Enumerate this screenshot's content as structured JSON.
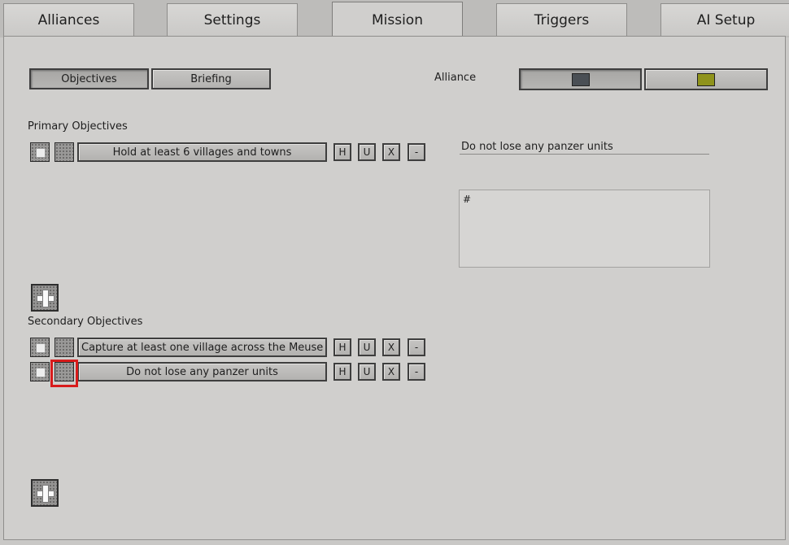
{
  "tabs": [
    {
      "label": "Alliances"
    },
    {
      "label": "Settings"
    },
    {
      "label": "Mission"
    },
    {
      "label": "Triggers"
    },
    {
      "label": "AI Setup"
    }
  ],
  "subtabs": {
    "objectives": "Objectives",
    "briefing": "Briefing"
  },
  "alliance": {
    "label": "Alliance",
    "colors": [
      "#4a4f55",
      "#8f931c"
    ]
  },
  "primary": {
    "heading": "Primary Objectives",
    "items": [
      {
        "text": "Hold at least 6 villages and towns"
      }
    ]
  },
  "secondary": {
    "heading": "Secondary Objectives",
    "items": [
      {
        "text": "Capture at least one village across the Meuse River"
      },
      {
        "text": "Do not lose any panzer units"
      }
    ]
  },
  "row_buttons": {
    "h": "H",
    "u": "U",
    "x": "X",
    "remove": "-"
  },
  "editor": {
    "title_value": "Do not lose any panzer units",
    "body_value": "#"
  }
}
